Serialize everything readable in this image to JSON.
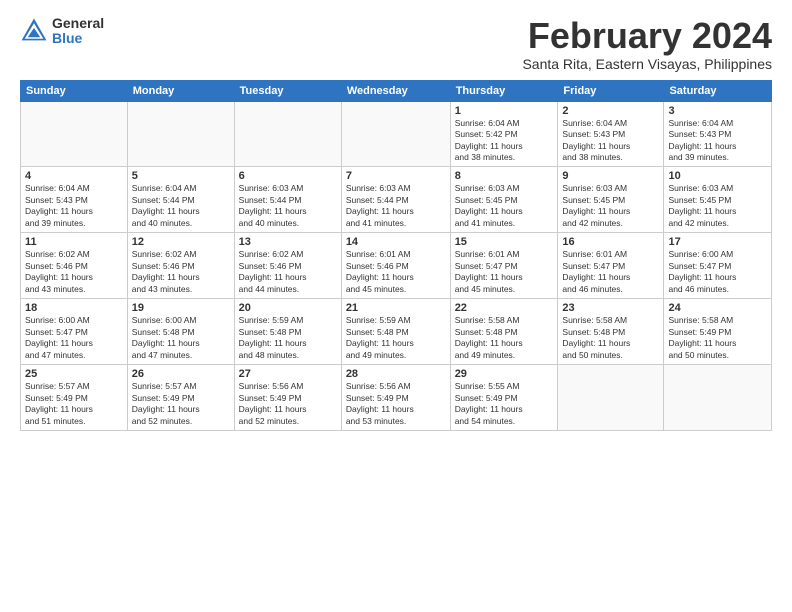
{
  "header": {
    "logo_general": "General",
    "logo_blue": "Blue",
    "month_title": "February 2024",
    "location": "Santa Rita, Eastern Visayas, Philippines"
  },
  "days_of_week": [
    "Sunday",
    "Monday",
    "Tuesday",
    "Wednesday",
    "Thursday",
    "Friday",
    "Saturday"
  ],
  "weeks": [
    [
      {
        "day": "",
        "info": ""
      },
      {
        "day": "",
        "info": ""
      },
      {
        "day": "",
        "info": ""
      },
      {
        "day": "",
        "info": ""
      },
      {
        "day": "1",
        "info": "Sunrise: 6:04 AM\nSunset: 5:42 PM\nDaylight: 11 hours\nand 38 minutes."
      },
      {
        "day": "2",
        "info": "Sunrise: 6:04 AM\nSunset: 5:43 PM\nDaylight: 11 hours\nand 38 minutes."
      },
      {
        "day": "3",
        "info": "Sunrise: 6:04 AM\nSunset: 5:43 PM\nDaylight: 11 hours\nand 39 minutes."
      }
    ],
    [
      {
        "day": "4",
        "info": "Sunrise: 6:04 AM\nSunset: 5:43 PM\nDaylight: 11 hours\nand 39 minutes."
      },
      {
        "day": "5",
        "info": "Sunrise: 6:04 AM\nSunset: 5:44 PM\nDaylight: 11 hours\nand 40 minutes."
      },
      {
        "day": "6",
        "info": "Sunrise: 6:03 AM\nSunset: 5:44 PM\nDaylight: 11 hours\nand 40 minutes."
      },
      {
        "day": "7",
        "info": "Sunrise: 6:03 AM\nSunset: 5:44 PM\nDaylight: 11 hours\nand 41 minutes."
      },
      {
        "day": "8",
        "info": "Sunrise: 6:03 AM\nSunset: 5:45 PM\nDaylight: 11 hours\nand 41 minutes."
      },
      {
        "day": "9",
        "info": "Sunrise: 6:03 AM\nSunset: 5:45 PM\nDaylight: 11 hours\nand 42 minutes."
      },
      {
        "day": "10",
        "info": "Sunrise: 6:03 AM\nSunset: 5:45 PM\nDaylight: 11 hours\nand 42 minutes."
      }
    ],
    [
      {
        "day": "11",
        "info": "Sunrise: 6:02 AM\nSunset: 5:46 PM\nDaylight: 11 hours\nand 43 minutes."
      },
      {
        "day": "12",
        "info": "Sunrise: 6:02 AM\nSunset: 5:46 PM\nDaylight: 11 hours\nand 43 minutes."
      },
      {
        "day": "13",
        "info": "Sunrise: 6:02 AM\nSunset: 5:46 PM\nDaylight: 11 hours\nand 44 minutes."
      },
      {
        "day": "14",
        "info": "Sunrise: 6:01 AM\nSunset: 5:46 PM\nDaylight: 11 hours\nand 45 minutes."
      },
      {
        "day": "15",
        "info": "Sunrise: 6:01 AM\nSunset: 5:47 PM\nDaylight: 11 hours\nand 45 minutes."
      },
      {
        "day": "16",
        "info": "Sunrise: 6:01 AM\nSunset: 5:47 PM\nDaylight: 11 hours\nand 46 minutes."
      },
      {
        "day": "17",
        "info": "Sunrise: 6:00 AM\nSunset: 5:47 PM\nDaylight: 11 hours\nand 46 minutes."
      }
    ],
    [
      {
        "day": "18",
        "info": "Sunrise: 6:00 AM\nSunset: 5:47 PM\nDaylight: 11 hours\nand 47 minutes."
      },
      {
        "day": "19",
        "info": "Sunrise: 6:00 AM\nSunset: 5:48 PM\nDaylight: 11 hours\nand 47 minutes."
      },
      {
        "day": "20",
        "info": "Sunrise: 5:59 AM\nSunset: 5:48 PM\nDaylight: 11 hours\nand 48 minutes."
      },
      {
        "day": "21",
        "info": "Sunrise: 5:59 AM\nSunset: 5:48 PM\nDaylight: 11 hours\nand 49 minutes."
      },
      {
        "day": "22",
        "info": "Sunrise: 5:58 AM\nSunset: 5:48 PM\nDaylight: 11 hours\nand 49 minutes."
      },
      {
        "day": "23",
        "info": "Sunrise: 5:58 AM\nSunset: 5:48 PM\nDaylight: 11 hours\nand 50 minutes."
      },
      {
        "day": "24",
        "info": "Sunrise: 5:58 AM\nSunset: 5:49 PM\nDaylight: 11 hours\nand 50 minutes."
      }
    ],
    [
      {
        "day": "25",
        "info": "Sunrise: 5:57 AM\nSunset: 5:49 PM\nDaylight: 11 hours\nand 51 minutes."
      },
      {
        "day": "26",
        "info": "Sunrise: 5:57 AM\nSunset: 5:49 PM\nDaylight: 11 hours\nand 52 minutes."
      },
      {
        "day": "27",
        "info": "Sunrise: 5:56 AM\nSunset: 5:49 PM\nDaylight: 11 hours\nand 52 minutes."
      },
      {
        "day": "28",
        "info": "Sunrise: 5:56 AM\nSunset: 5:49 PM\nDaylight: 11 hours\nand 53 minutes."
      },
      {
        "day": "29",
        "info": "Sunrise: 5:55 AM\nSunset: 5:49 PM\nDaylight: 11 hours\nand 54 minutes."
      },
      {
        "day": "",
        "info": ""
      },
      {
        "day": "",
        "info": ""
      }
    ]
  ]
}
